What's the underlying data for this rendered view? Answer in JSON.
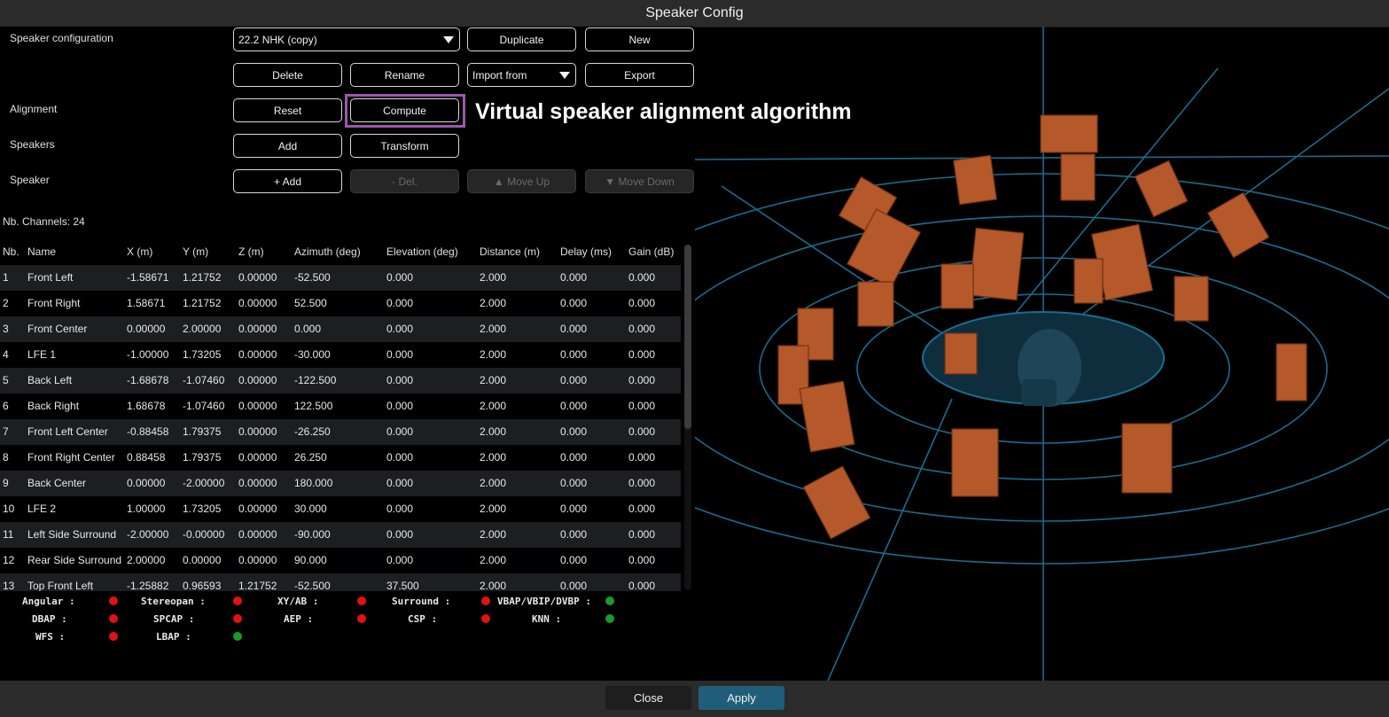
{
  "window": {
    "title": "Speaker Config"
  },
  "config": {
    "speaker_configuration_label": "Speaker configuration",
    "alignment_label": "Alignment",
    "speakers_label": "Speakers",
    "speaker_label": "Speaker",
    "preset_value": "22.2 NHK (copy)",
    "duplicate": "Duplicate",
    "new": "New",
    "delete": "Delete",
    "rename": "Rename",
    "import_from": "Import from",
    "export": "Export",
    "reset": "Reset",
    "compute": "Compute",
    "add": "Add",
    "transform": "Transform",
    "speaker_add": "+ Add",
    "speaker_del": "- Del.",
    "move_up": "▲ Move Up",
    "move_down": "▼ Move Down"
  },
  "annotation": "Virtual speaker alignment algorithm",
  "channels_label": "Nb. Channels: 24",
  "table": {
    "headers": [
      "Nb.",
      "Name",
      "X (m)",
      "Y (m)",
      "Z (m)",
      "Azimuth (deg)",
      "Elevation (deg)",
      "Distance (m)",
      "Delay (ms)",
      "Gain (dB)"
    ],
    "rows": [
      [
        "1",
        "Front Left",
        "-1.58671",
        "1.21752",
        "0.00000",
        "-52.500",
        "0.000",
        "2.000",
        "0.000",
        "0.000"
      ],
      [
        "2",
        "Front Right",
        "1.58671",
        "1.21752",
        "0.00000",
        "52.500",
        "0.000",
        "2.000",
        "0.000",
        "0.000"
      ],
      [
        "3",
        "Front Center",
        "0.00000",
        "2.00000",
        "0.00000",
        "0.000",
        "0.000",
        "2.000",
        "0.000",
        "0.000"
      ],
      [
        "4",
        "LFE 1",
        "-1.00000",
        "1.73205",
        "0.00000",
        "-30.000",
        "0.000",
        "2.000",
        "0.000",
        "0.000"
      ],
      [
        "5",
        "Back Left",
        "-1.68678",
        "-1.07460",
        "0.00000",
        "-122.500",
        "0.000",
        "2.000",
        "0.000",
        "0.000"
      ],
      [
        "6",
        "Back Right",
        "1.68678",
        "-1.07460",
        "0.00000",
        "122.500",
        "0.000",
        "2.000",
        "0.000",
        "0.000"
      ],
      [
        "7",
        "Front Left Center",
        "-0.88458",
        "1.79375",
        "0.00000",
        "-26.250",
        "0.000",
        "2.000",
        "0.000",
        "0.000"
      ],
      [
        "8",
        "Front Right Center",
        "0.88458",
        "1.79375",
        "0.00000",
        "26.250",
        "0.000",
        "2.000",
        "0.000",
        "0.000"
      ],
      [
        "9",
        "Back Center",
        "0.00000",
        "-2.00000",
        "0.00000",
        "180.000",
        "0.000",
        "2.000",
        "0.000",
        "0.000"
      ],
      [
        "10",
        "LFE 2",
        "1.00000",
        "1.73205",
        "0.00000",
        "30.000",
        "0.000",
        "2.000",
        "0.000",
        "0.000"
      ],
      [
        "11",
        "Left Side Surround",
        "-2.00000",
        "-0.00000",
        "0.00000",
        "-90.000",
        "0.000",
        "2.000",
        "0.000",
        "0.000"
      ],
      [
        "12",
        "Rear Side Surround",
        "2.00000",
        "0.00000",
        "0.00000",
        "90.000",
        "0.000",
        "2.000",
        "0.000",
        "0.000"
      ],
      [
        "13",
        "Top Front Left",
        "-1.25882",
        "0.96593",
        "1.21752",
        "-52.500",
        "37.500",
        "2.000",
        "0.000",
        "0.000"
      ]
    ]
  },
  "algorithms": [
    {
      "label": "Angular :",
      "status": "red"
    },
    {
      "label": "Stereopan :",
      "status": "red"
    },
    {
      "label": "XY/AB :",
      "status": "red"
    },
    {
      "label": "Surround :",
      "status": "red"
    },
    {
      "label": "VBAP/VBIP/DVBP :",
      "status": "green"
    },
    {
      "label": "DBAP :",
      "status": "red"
    },
    {
      "label": "SPCAP :",
      "status": "red"
    },
    {
      "label": "AEP :",
      "status": "red"
    },
    {
      "label": "CSP :",
      "status": "red"
    },
    {
      "label": "KNN :",
      "status": "green"
    },
    {
      "label": "WFS :",
      "status": "red"
    },
    {
      "label": "LBAP :",
      "status": "green"
    }
  ],
  "footer": {
    "close": "Close",
    "apply": "Apply"
  },
  "colors": {
    "accent": "#1f5e78",
    "status_red": "#e11212",
    "status_green": "#1a9a2a",
    "grid": "#1b6c8c",
    "speaker": "#b5582a",
    "highlight": "#9b59a8"
  }
}
